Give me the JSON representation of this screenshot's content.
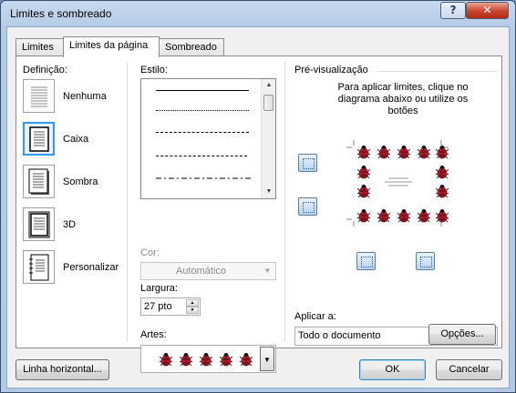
{
  "window": {
    "title": "Limites e sombreado"
  },
  "title_buttons": {
    "help": "?",
    "close": "✕"
  },
  "tabs": [
    {
      "label": "Limites",
      "active": false
    },
    {
      "label": "Limites da página",
      "active": true
    },
    {
      "label": "Sombreado",
      "active": false
    }
  ],
  "definition": {
    "heading": "Definição:",
    "options": [
      {
        "label": "Nenhuma",
        "selected": false
      },
      {
        "label": "Caixa",
        "selected": true
      },
      {
        "label": "Sombra",
        "selected": false
      },
      {
        "label": "3D",
        "selected": false
      },
      {
        "label": "Personalizar",
        "selected": false
      }
    ]
  },
  "style": {
    "heading": "Estilo:",
    "lines": [
      "solid",
      "dotted",
      "dashed-fine",
      "dashed",
      "dash-dot"
    ]
  },
  "color": {
    "label": "Cor:",
    "value": "Automático",
    "disabled": true
  },
  "width": {
    "label": "Largura:",
    "value": "27 pto"
  },
  "art": {
    "label": "Artes:",
    "icon": "ladybug-icon",
    "count": 5
  },
  "preview": {
    "heading": "Pré-visualização",
    "instructions": "Para aplicar limites, clique no diagrama abaixo ou utilize os botões",
    "buttons": [
      "top-border",
      "left-border",
      "bottom-border",
      "right-border"
    ]
  },
  "apply_to": {
    "label": "Aplicar a:",
    "value": "Todo o documento"
  },
  "buttons": {
    "options": "Opções...",
    "horizontal_line": "Linha horizontal...",
    "ok": "OK",
    "cancel": "Cancelar"
  },
  "colors": {
    "accent_selected": "#3399ff",
    "ladybug_red": "#c0182c"
  }
}
